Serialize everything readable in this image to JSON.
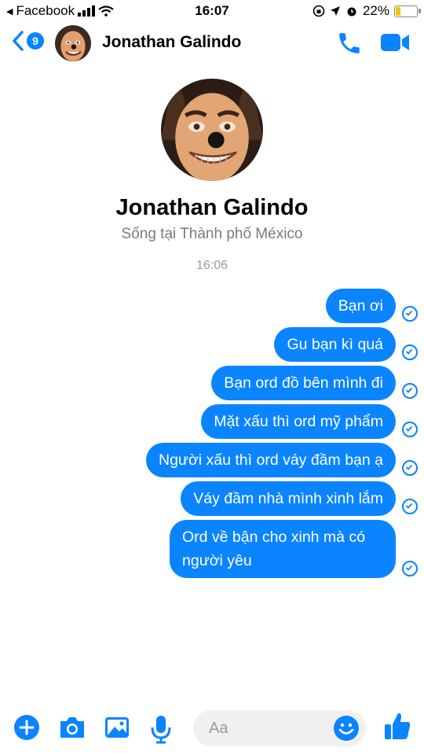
{
  "status_bar": {
    "carrier": "Facebook",
    "time": "16:07",
    "battery": "22%",
    "battery_level": 0.22
  },
  "header": {
    "unread_count": "9",
    "contact_name": "Jonathan Galindo"
  },
  "profile": {
    "name": "Jonathan Galindo",
    "location": "Sống tại Thành phố México",
    "timestamp": "16:06"
  },
  "messages": [
    {
      "text": "Bạn ơi"
    },
    {
      "text": "Gu bạn kì quá"
    },
    {
      "text": "Bạn ord đồ bên mình đi"
    },
    {
      "text": "Mặt xấu thì ord mỹ phẩm"
    },
    {
      "text": "Người xấu thì ord váy đầm bạn ạ"
    },
    {
      "text": "Váy đầm nhà mình xinh lắm"
    },
    {
      "text": "Ord về bận cho xinh mà có người yêu"
    }
  ],
  "composer": {
    "placeholder": "Aa"
  },
  "colors": {
    "accent": "#0a84ff",
    "battery": "#f2c400"
  }
}
